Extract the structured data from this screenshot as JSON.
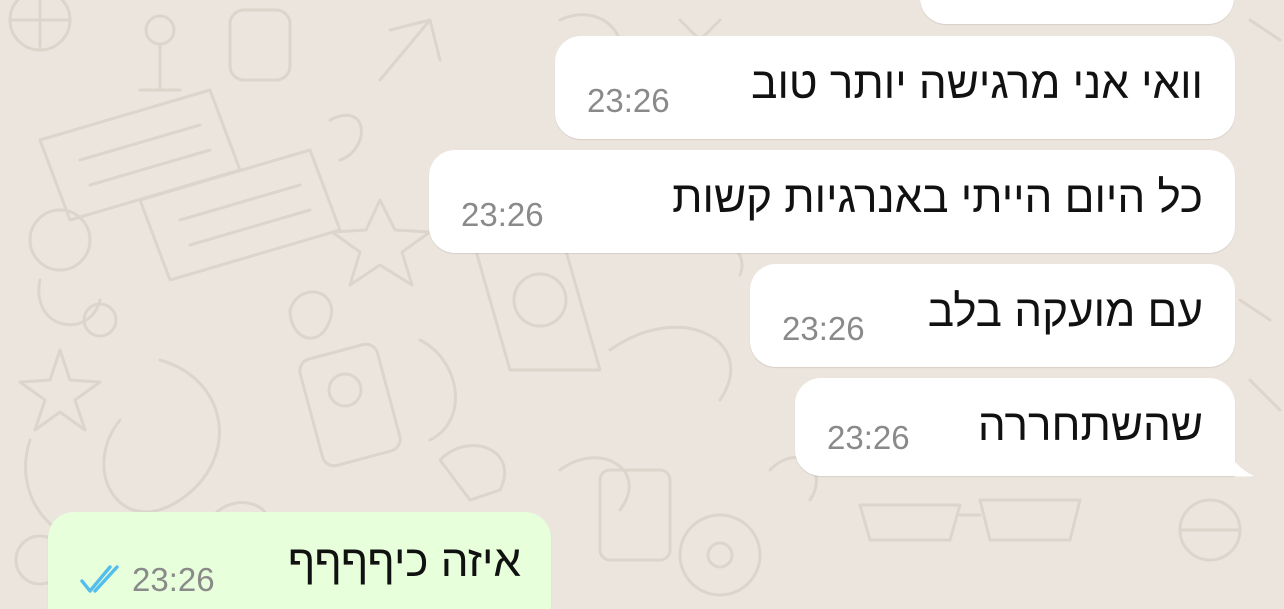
{
  "chat": {
    "messages": [
      {
        "text": "וואי אני מרגישה יותר טוב",
        "time": "23:26",
        "direction": "incoming"
      },
      {
        "text": "כל היום הייתי באנרגיות קשות",
        "time": "23:26",
        "direction": "incoming"
      },
      {
        "text": "עם מועקה בלב",
        "time": "23:26",
        "direction": "incoming"
      },
      {
        "text": "שהשתחררה",
        "time": "23:26",
        "direction": "incoming"
      },
      {
        "text": "איזה כיףףףף",
        "time": "23:26",
        "direction": "outgoing",
        "status": "read"
      }
    ]
  },
  "colors": {
    "background": "#ece5dd",
    "incoming_bubble": "#ffffff",
    "outgoing_bubble": "#e7ffdb",
    "timestamp": "#8a8a8a",
    "read_ticks": "#53bdeb"
  },
  "icons": {
    "read_receipt": "double-check-icon"
  }
}
